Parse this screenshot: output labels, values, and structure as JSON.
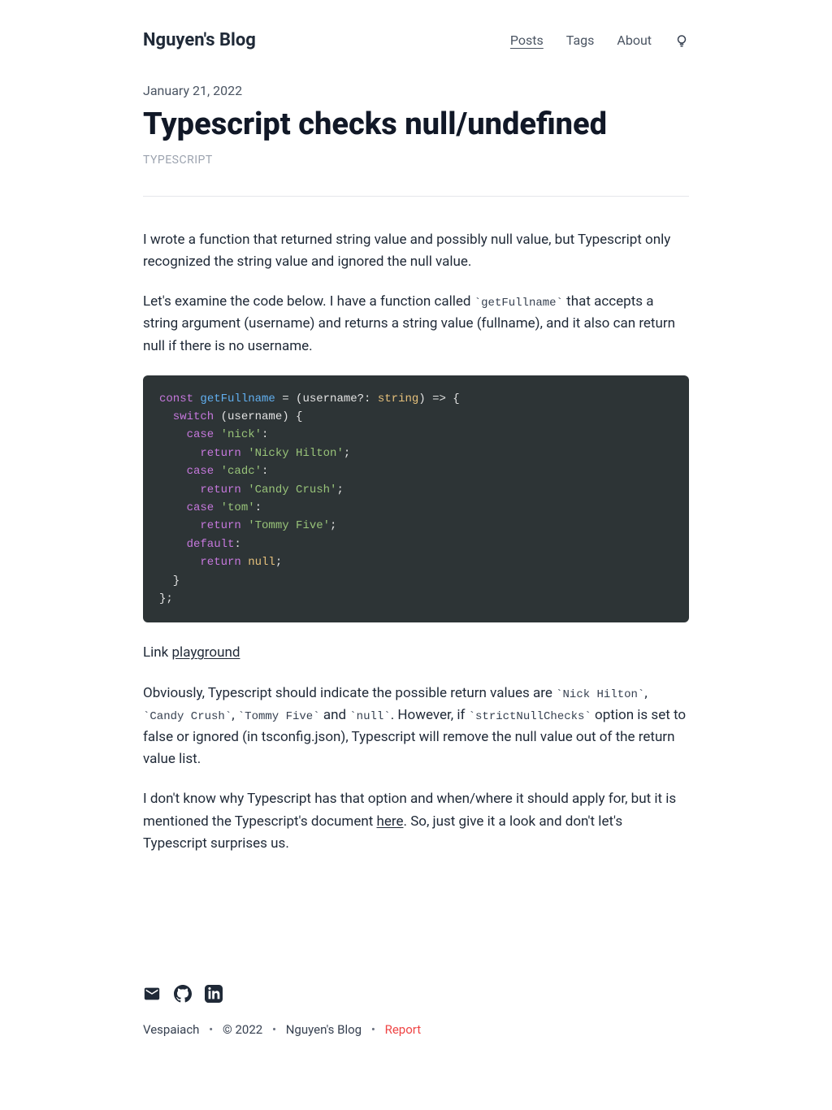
{
  "header": {
    "site_title": "Nguyen's Blog",
    "nav": {
      "posts": "Posts",
      "tags": "Tags",
      "about": "About"
    }
  },
  "post": {
    "date": "January 21, 2022",
    "title": "Typescript checks null/undefined",
    "tag": "TYPESCRIPT",
    "p1": "I wrote a function that returned string value and possibly null value, but Typescript only recognized the string value and ignored the null value.",
    "p2_a": "Let's examine the code below. I have a function called ",
    "p2_code": "`getFullname`",
    "p2_b": " that accepts a string argument (username) and returns a string value (fullname), and it also can return null if there is no username.",
    "link_label": "Link ",
    "playground_link": "playground",
    "p3_a": "Obviously, Typescript should indicate the possible return values are ",
    "p3_code1": "`Nick Hilton`",
    "p3_sep1": ", ",
    "p3_code2": "`Candy Crush`",
    "p3_sep2": ", ",
    "p3_code3": "`Tommy Five`",
    "p3_sep3": " and ",
    "p3_code4": "`null`",
    "p3_b": ". However, if ",
    "p3_code5": "`strictNullChecks`",
    "p3_c": " option is set to false or ignored (in tsconfig.json), Typescript will remove the null value out of the return value list.",
    "p4_a": "I don't know why Typescript has that option and when/where it should apply for, but it is mentioned the Typescript's document ",
    "p4_link": "here",
    "p4_b": ". So, just give it a look and don't let's Typescript surprises us."
  },
  "code": {
    "line1_kw": "const",
    "line1_func": " getFullname",
    "line1_eq": " = (username?: ",
    "line1_type": "string",
    "line1_end": ") => {",
    "line2_kw": "  switch",
    "line2_rest": " (username) {",
    "line3_kw": "    case",
    "line3_str": " 'nick'",
    "line3_colon": ":",
    "line4_kw": "      return",
    "line4_str": " 'Nicky Hilton'",
    "line4_semi": ";",
    "line5_kw": "    case",
    "line5_str": " 'cadc'",
    "line5_colon": ":",
    "line6_kw": "      return",
    "line6_str": " 'Candy Crush'",
    "line6_semi": ";",
    "line7_kw": "    case",
    "line7_str": " 'tom'",
    "line7_colon": ":",
    "line8_kw": "      return",
    "line8_str": " 'Tommy Five'",
    "line8_semi": ";",
    "line9_kw": "    default",
    "line9_colon": ":",
    "line10_kw": "      return",
    "line10_null": " null",
    "line10_semi": ";",
    "line11": "  }",
    "line12": "};"
  },
  "footer": {
    "name": "Vespaiach",
    "copyright": "© 2022",
    "blog": "Nguyen's Blog",
    "report": "Report",
    "sep": "•"
  }
}
